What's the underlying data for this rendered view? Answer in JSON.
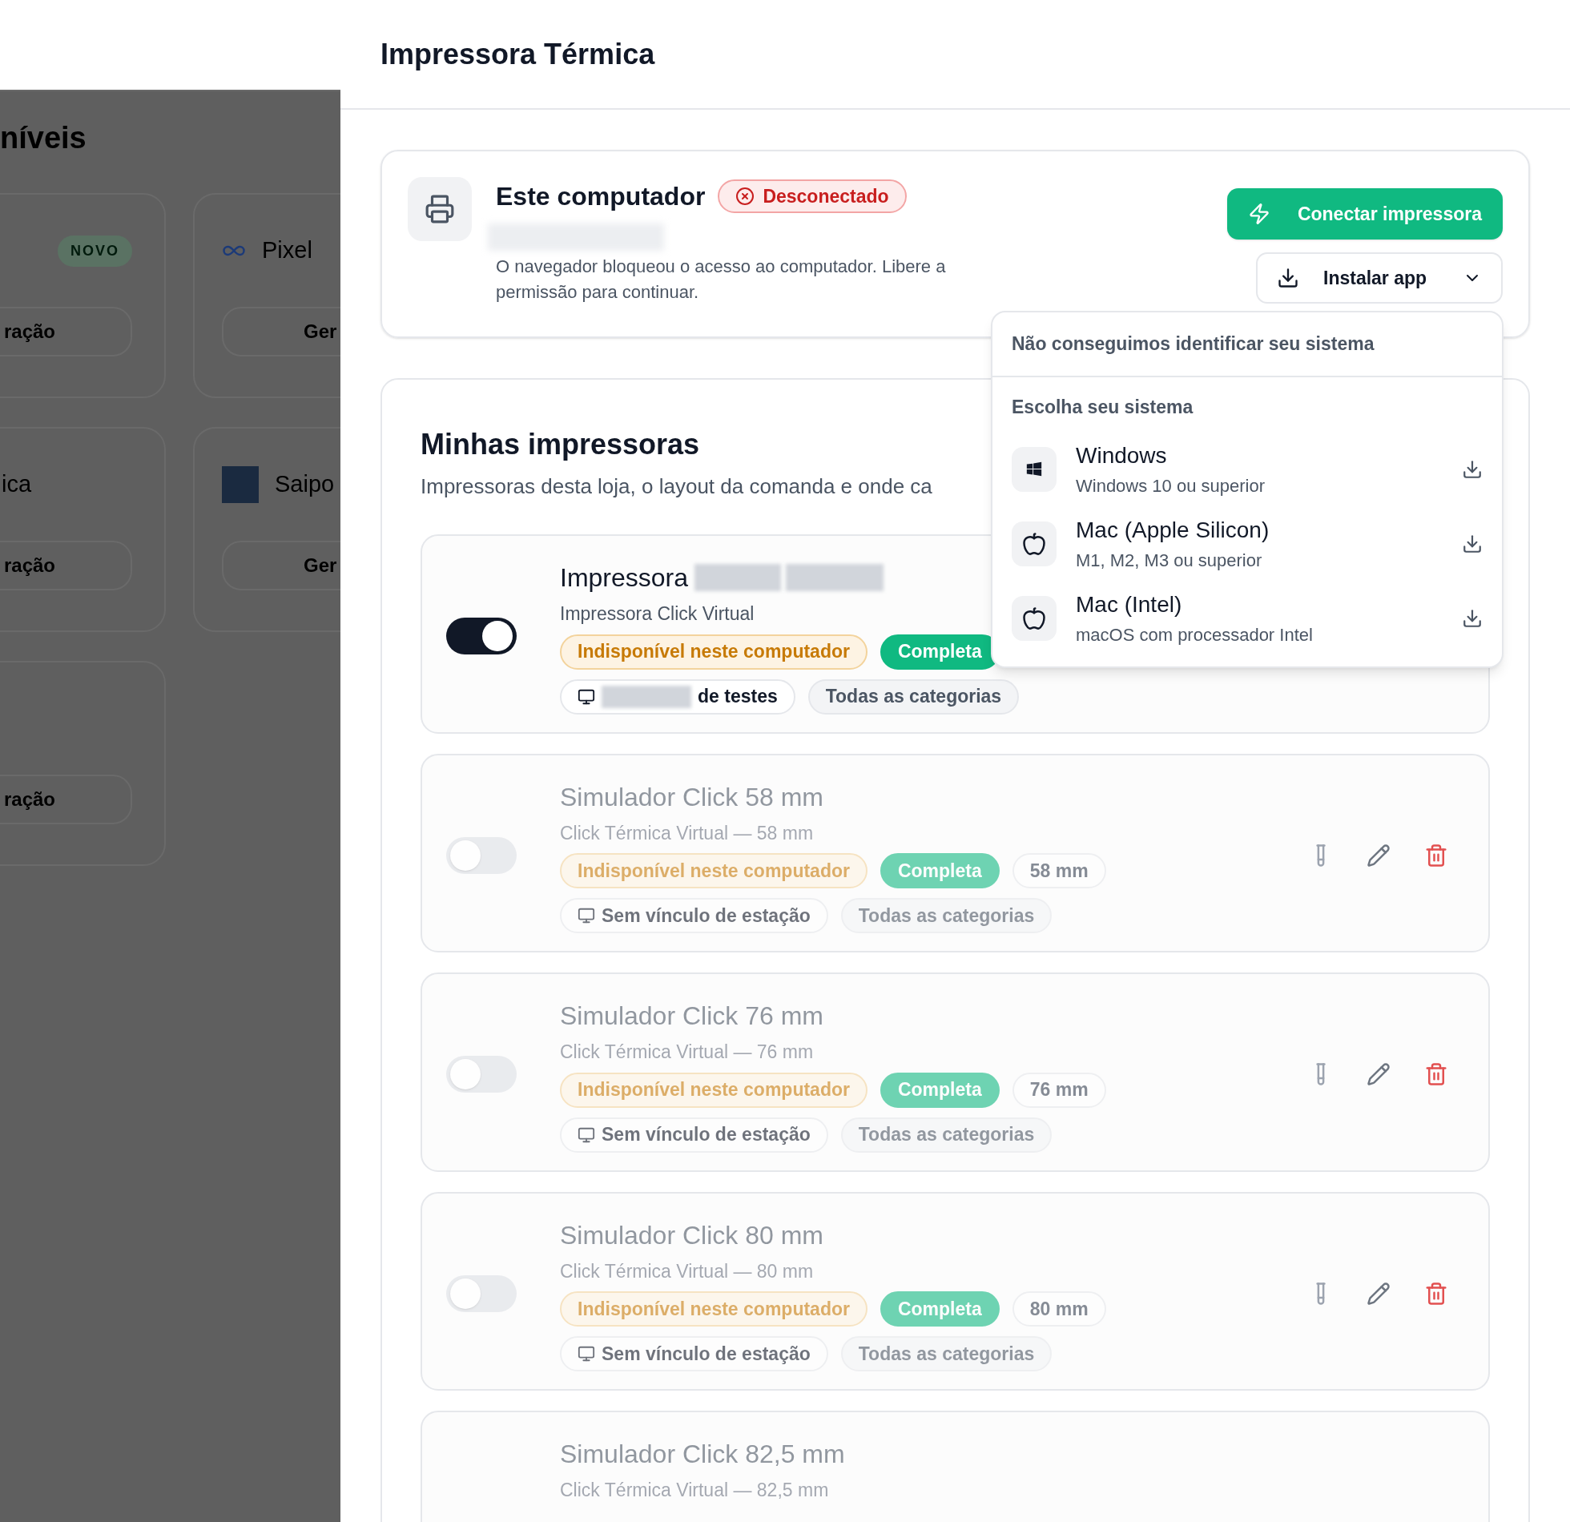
{
  "backdrop": {
    "heading": "níveis",
    "cards": [
      {
        "kind": "badge",
        "badge": "NOVO",
        "button": "ração"
      },
      {
        "kind": "infinity",
        "title": "Pixel",
        "button": "Ger"
      },
      {
        "kind": "plain",
        "title": "ica",
        "button": "ração"
      },
      {
        "kind": "avatar",
        "title": "Saipo",
        "button": "Ger"
      },
      {
        "kind": "plain",
        "button": "ração"
      }
    ]
  },
  "drawer": {
    "title": "Impressora Térmica"
  },
  "computer": {
    "title": "Este computador",
    "status": {
      "kind": "error",
      "label": "Desconectado"
    },
    "message": "O navegador bloqueou o acesso ao computador. Libere a permissão para continuar.",
    "connect_button": "Conectar impressora",
    "install_button": "Instalar app"
  },
  "install_menu": {
    "open": true,
    "notice": "Não conseguimos identificar seu sistema",
    "section": "Escolha seu sistema",
    "options": [
      {
        "kind": "windows",
        "name": "Windows",
        "detail": "Windows 10 ou superior"
      },
      {
        "kind": "apple",
        "name": "Mac (Apple Silicon)",
        "detail": "M1, M2, M3 ou superior"
      },
      {
        "kind": "apple",
        "name": "Mac (Intel)",
        "detail": "macOS com processador Intel"
      }
    ]
  },
  "printers": {
    "title": "Minhas impressoras",
    "subtitle": "Impressoras desta loja, o layout da comanda e onde ca",
    "items": [
      {
        "name": "Impressora",
        "name_redacted": true,
        "model": "Impressora Click Virtual",
        "on": true,
        "chips": [
          {
            "kind": "warning",
            "label": "Indisponível neste computador"
          },
          {
            "kind": "success",
            "label": "Completa"
          }
        ],
        "station": {
          "label": "de testes",
          "redacted": true
        },
        "categories": "Todas as categorias",
        "actions": false
      },
      {
        "name": "Simulador Click 58 mm",
        "model": "Click Térmica Virtual — 58 mm",
        "on": false,
        "chips": [
          {
            "kind": "warning",
            "label": "Indisponível neste computador"
          },
          {
            "kind": "success",
            "label": "Completa"
          },
          {
            "kind": "outline",
            "label": "58 mm"
          }
        ],
        "station": {
          "label": "Sem vínculo de estação",
          "redacted": false
        },
        "categories": "Todas as categorias",
        "actions": true
      },
      {
        "name": "Simulador Click 76 mm",
        "model": "Click Térmica Virtual — 76 mm",
        "on": false,
        "chips": [
          {
            "kind": "warning",
            "label": "Indisponível neste computador"
          },
          {
            "kind": "success",
            "label": "Completa"
          },
          {
            "kind": "outline",
            "label": "76 mm"
          }
        ],
        "station": {
          "label": "Sem vínculo de estação",
          "redacted": false
        },
        "categories": "Todas as categorias",
        "actions": true
      },
      {
        "name": "Simulador Click 80 mm",
        "model": "Click Térmica Virtual — 80 mm",
        "on": false,
        "chips": [
          {
            "kind": "warning",
            "label": "Indisponível neste computador"
          },
          {
            "kind": "success",
            "label": "Completa"
          },
          {
            "kind": "outline",
            "label": "80 mm"
          }
        ],
        "station": {
          "label": "Sem vínculo de estação",
          "redacted": false
        },
        "categories": "Todas as categorias",
        "actions": true
      },
      {
        "name": "Simulador Click 82,5 mm",
        "model": "Click Térmica Virtual — 82,5 mm"
      }
    ]
  }
}
